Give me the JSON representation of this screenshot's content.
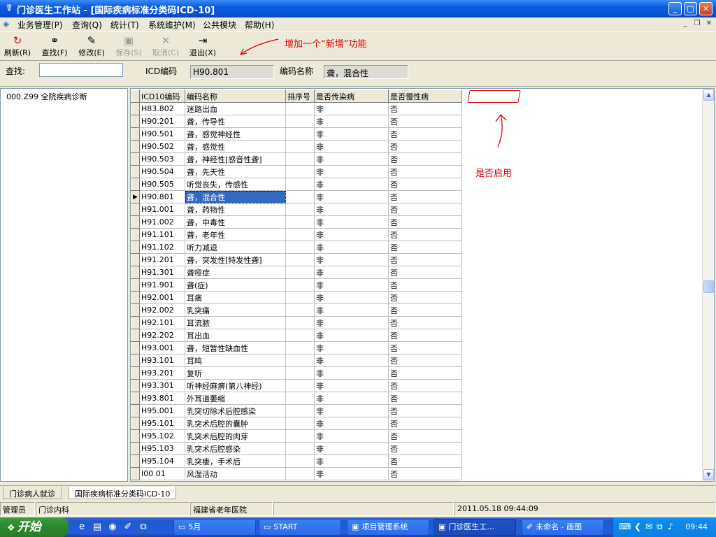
{
  "window": {
    "title": "门诊医生工作站 - [国际疾病标准分类码ICD-10]",
    "min_label": "_",
    "max_label": "□",
    "close_label": "✕",
    "app_icon": "caduceus-icon"
  },
  "menu": {
    "items": [
      "业务管理(P)",
      "查询(Q)",
      "统计(T)",
      "系统维护(M)",
      "公共模块",
      "帮助(H)"
    ],
    "mdi_min": "_",
    "mdi_restore": "❐",
    "mdi_close": "✕"
  },
  "toolbar": {
    "refresh": "刷新(R)",
    "find": "查找(F)",
    "edit": "修改(E)",
    "save": "保存(S)",
    "cancel": "取消(C)",
    "exit": "退出(X)",
    "icons": {
      "refresh": "refresh-icon",
      "find": "binoculars-icon",
      "edit": "edit-icon",
      "save": "save-icon",
      "cancel": "cancel-icon",
      "exit": "exit-icon"
    }
  },
  "annotations": {
    "add_feature": "增加一个“新增”功能",
    "enable_flag": "是否启用",
    "color": "#e00000"
  },
  "search": {
    "label": "查找:",
    "value": "",
    "code_label": "ICD编码",
    "code_value": "H90.801",
    "name_label": "编码名称",
    "name_value": "聋，混合性"
  },
  "tree": {
    "root": "000.Z99 全院疾病诊断"
  },
  "grid": {
    "columns": [
      "ICD10编码",
      "编码名称",
      "排序号",
      "是否传染病",
      "是否慢性病"
    ],
    "selected_row": 7,
    "rows": [
      [
        "H83.802",
        "迷路出血",
        "",
        "非",
        "否"
      ],
      [
        "H90.201",
        "聋，传导性",
        "",
        "非",
        "否"
      ],
      [
        "H90.501",
        "聋，感觉神经性",
        "",
        "非",
        "否"
      ],
      [
        "H90.502",
        "聋，感觉性",
        "",
        "非",
        "否"
      ],
      [
        "H90.503",
        "聋，神经性[感音性聋]",
        "",
        "非",
        "否"
      ],
      [
        "H90.504",
        "聋，先天性",
        "",
        "非",
        "否"
      ],
      [
        "H90.505",
        "听觉丧失，传感性",
        "",
        "非",
        "否"
      ],
      [
        "H90.801",
        "聋，混合性",
        "",
        "非",
        "否"
      ],
      [
        "H91.001",
        "聋，药物性",
        "",
        "非",
        "否"
      ],
      [
        "H91.002",
        "聋，中毒性",
        "",
        "非",
        "否"
      ],
      [
        "H91.101",
        "聋，老年性",
        "",
        "非",
        "否"
      ],
      [
        "H91.102",
        "听力减退",
        "",
        "非",
        "否"
      ],
      [
        "H91.201",
        "聋，突发性[特发性聋]",
        "",
        "非",
        "否"
      ],
      [
        "H91.301",
        "聋哑症",
        "",
        "非",
        "否"
      ],
      [
        "H91.901",
        "聋(症)",
        "",
        "非",
        "否"
      ],
      [
        "H92.001",
        "耳痛",
        "",
        "非",
        "否"
      ],
      [
        "H92.002",
        "乳突痛",
        "",
        "非",
        "否"
      ],
      [
        "H92.101",
        "耳流脓",
        "",
        "非",
        "否"
      ],
      [
        "H92.202",
        "耳出血",
        "",
        "非",
        "否"
      ],
      [
        "H93.001",
        "聋，短暂性缺血性",
        "",
        "非",
        "否"
      ],
      [
        "H93.101",
        "耳鸣",
        "",
        "非",
        "否"
      ],
      [
        "H93.201",
        "复听",
        "",
        "非",
        "否"
      ],
      [
        "H93.301",
        "听神经麻痹(第八神经)",
        "",
        "非",
        "否"
      ],
      [
        "H93.801",
        "外耳道萎缩",
        "",
        "非",
        "否"
      ],
      [
        "H95.001",
        "乳突切除术后腔感染",
        "",
        "非",
        "否"
      ],
      [
        "H95.101",
        "乳突术后腔的囊肿",
        "",
        "非",
        "否"
      ],
      [
        "H95.102",
        "乳突术后腔的肉芽",
        "",
        "非",
        "否"
      ],
      [
        "H95.103",
        "乳突术后腔感染",
        "",
        "非",
        "否"
      ],
      [
        "H95.104",
        "乳突瘘，手术后",
        "",
        "非",
        "否"
      ],
      [
        "I00 01",
        "风湿活动",
        "",
        "非",
        "否"
      ]
    ]
  },
  "tabs": [
    "门诊病人就诊",
    "国际疾病标准分类码ICD-10"
  ],
  "status": {
    "user": "管理员",
    "dept": "门诊内科",
    "blank1": "",
    "hospital": "福建省老年医院",
    "blank2": "",
    "datetime": "2011.05.18 09:44:09"
  },
  "taskbar": {
    "start": "开始",
    "tasks": [
      "5月",
      "START",
      "项目管理系统",
      "门诊医生工...",
      "未命名 - 画图"
    ],
    "active_task": 3,
    "clock": "09:44"
  }
}
